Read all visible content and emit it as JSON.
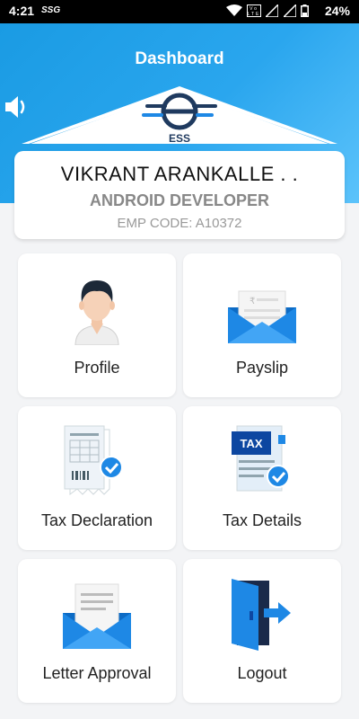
{
  "status_bar": {
    "time": "4:21",
    "carrier": "SSG",
    "indicators": "▾ △ △",
    "battery_percent": "24%",
    "icons": [
      "wifi-icon",
      "volte-icon",
      "signal-icon",
      "signal-icon",
      "battery-icon"
    ]
  },
  "header": {
    "title": "Dashboard",
    "logo_text": "ESS",
    "logo_letter": "e",
    "speaker_icon": "speaker-icon"
  },
  "employee": {
    "name": "VIKRANT ARANKALLE . .",
    "role": "ANDROID DEVELOPER",
    "code": "EMP CODE: A10372"
  },
  "tiles": [
    {
      "label": "Profile",
      "icon": "profile-avatar-icon"
    },
    {
      "label": "Payslip",
      "icon": "payslip-envelope-icon"
    },
    {
      "label": "Tax Declaration",
      "icon": "tax-declaration-icon"
    },
    {
      "label": "Tax Details",
      "icon": "tax-details-icon"
    },
    {
      "label": "Letter Approval",
      "icon": "letter-approval-icon"
    },
    {
      "label": "Logout",
      "icon": "logout-door-icon"
    }
  ],
  "colors": {
    "header_gradient_start": "#1a9be3",
    "header_gradient_end": "#5cc3fb",
    "icon_blue": "#1e88e5",
    "icon_dark_blue": "#0d47a1",
    "background": "#f3f4f6"
  }
}
